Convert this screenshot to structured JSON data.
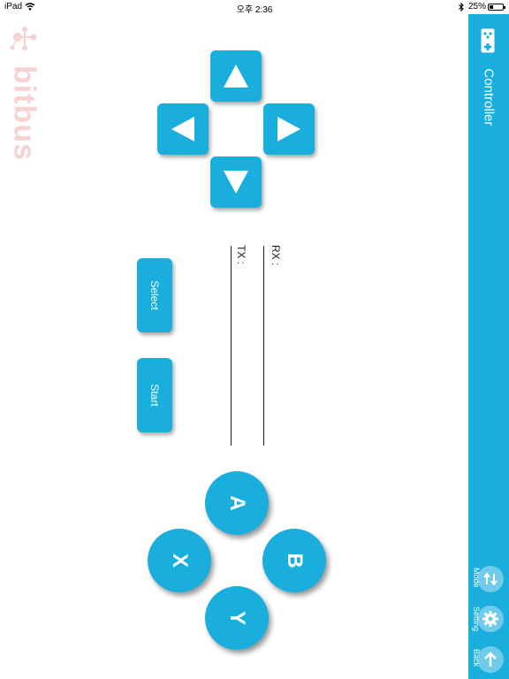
{
  "status_bar": {
    "device": "iPad",
    "time": "오후 2:36",
    "battery": "25%",
    "battery_level": 0.25
  },
  "logo": {
    "text": "bitbus"
  },
  "sidebar": {
    "title": "Controller",
    "buttons": [
      {
        "label": "Mode",
        "icon": "swap-icon"
      },
      {
        "label": "Setting",
        "icon": "gear-icon"
      },
      {
        "label": "Back",
        "icon": "up-arrow-icon"
      }
    ],
    "color": "#1aaedc"
  },
  "dpad": {
    "up": "up-arrow-icon",
    "left": "left-arrow-icon",
    "right": "right-arrow-icon",
    "down": "down-arrow-icon"
  },
  "buttons": {
    "select": "Select",
    "start": "Start",
    "a": "A",
    "b": "B",
    "x": "X",
    "y": "Y"
  },
  "log": {
    "rx_label": "RX :",
    "tx_label": "TX :"
  }
}
